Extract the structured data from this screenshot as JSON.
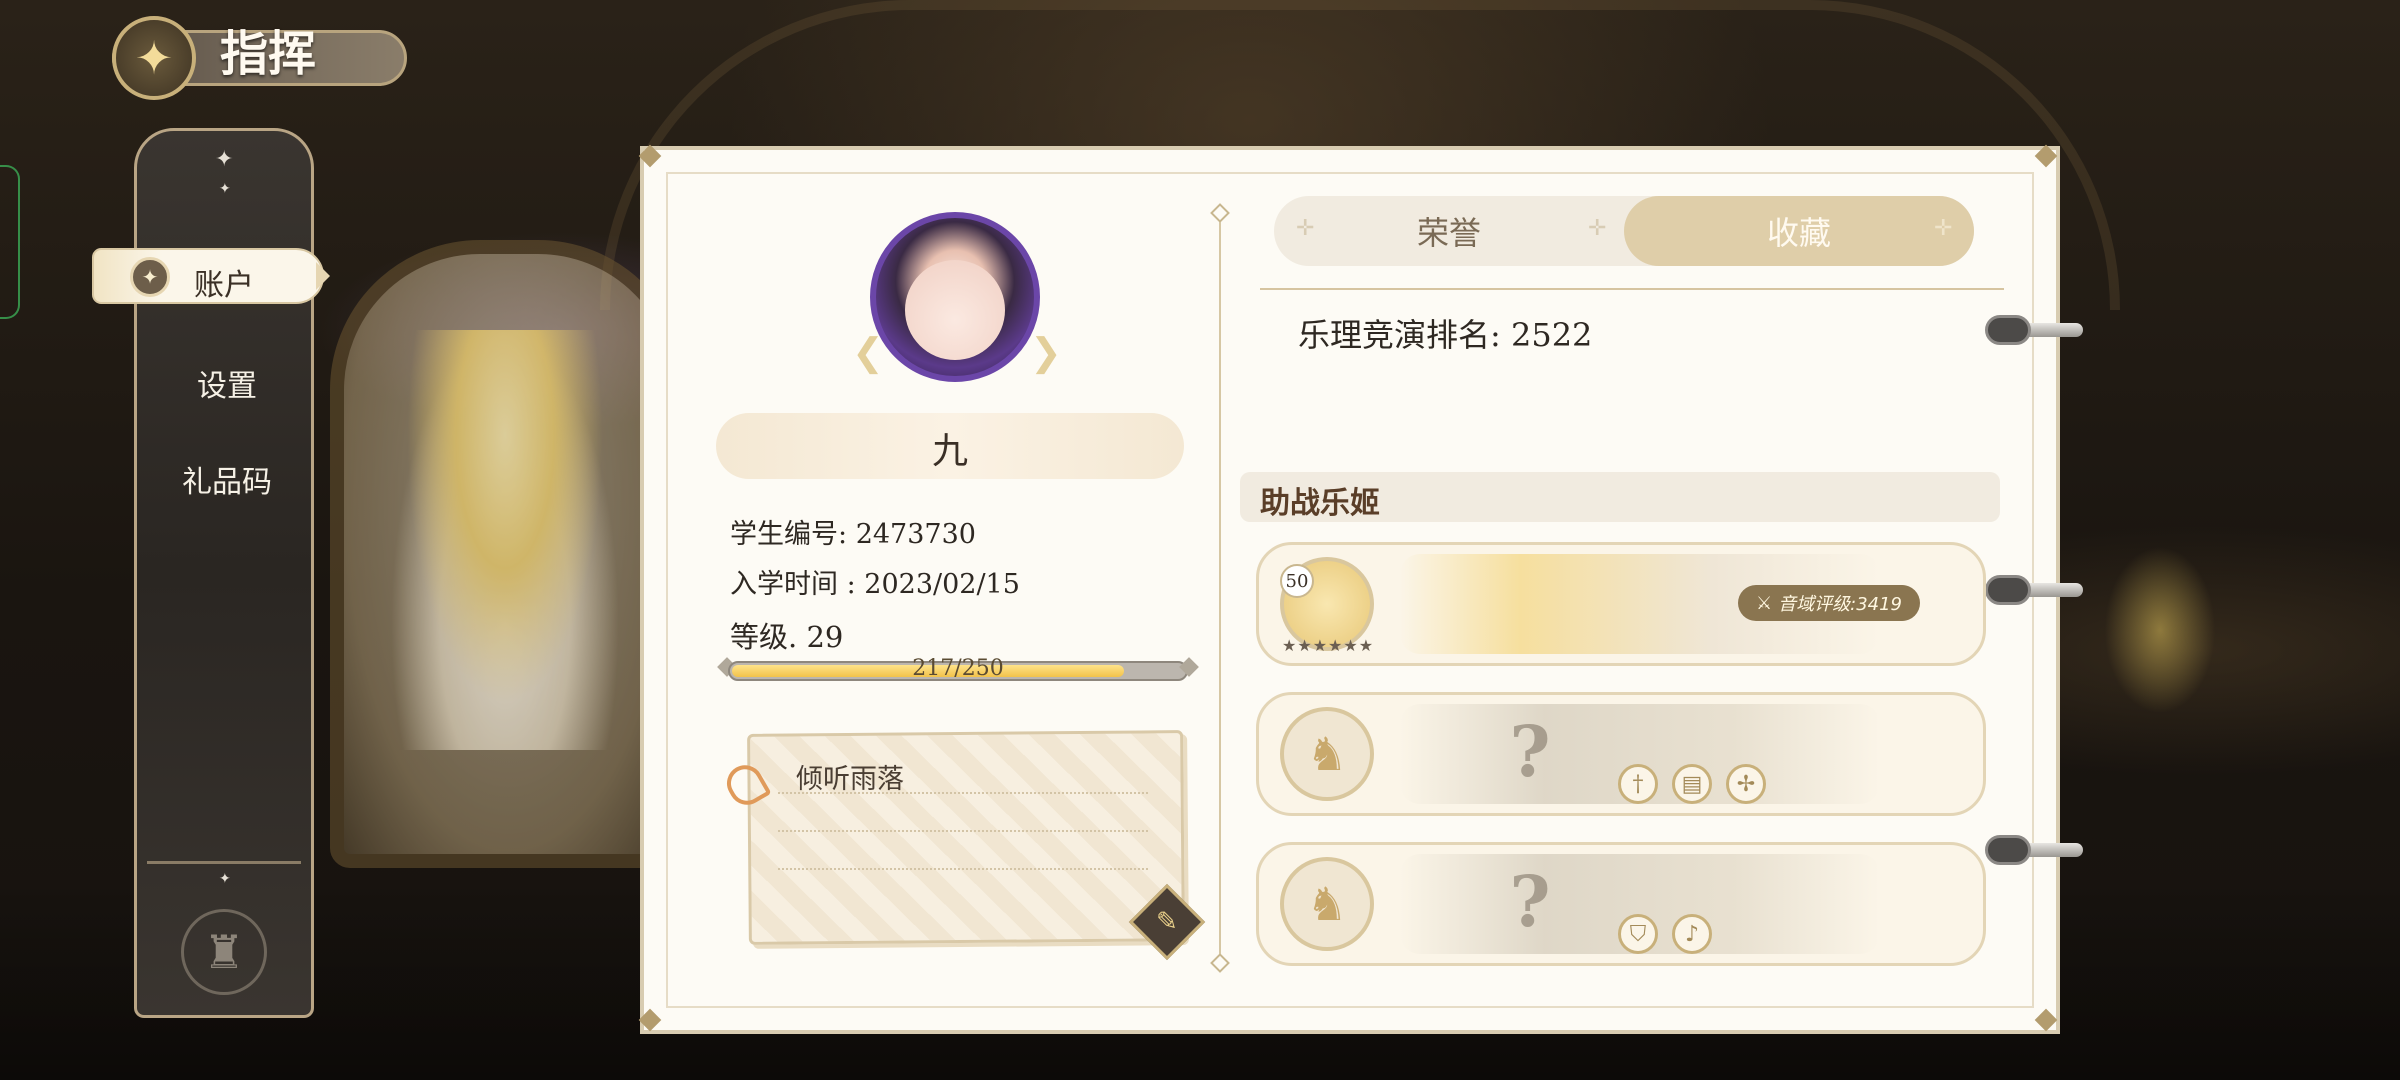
{
  "header": {
    "title": "指挥"
  },
  "sidebar": {
    "items": [
      {
        "label": "账户",
        "active": true
      },
      {
        "label": "设置",
        "active": false
      },
      {
        "label": "礼品码",
        "active": false
      }
    ]
  },
  "profile": {
    "name": "九",
    "student_id_label": "学生编号:",
    "student_id": "2473730",
    "enroll_label": "入学时间 :",
    "enroll_date": "2023/02/15",
    "level_label": "等级.",
    "level": "29",
    "xp_text": "217/250",
    "xp_fraction": 0.868,
    "note": "倾听雨落"
  },
  "tabs": {
    "honor": "荣誉",
    "collection": "收藏",
    "active": "collection"
  },
  "ranking": {
    "label": "乐理竞演排名:",
    "value": "2522"
  },
  "support": {
    "title": "助战乐姬",
    "slot1": {
      "level": "50",
      "stars": "★★★★★★",
      "rating": "音域评级:3419"
    }
  },
  "colors": {
    "accent_gold": "#c8b07a",
    "panel_bg": "#fdfbf5",
    "tab_active": "#dfcea9"
  },
  "icons": [
    "director-emblem-icon",
    "account-icon",
    "crest-icon",
    "pin-icon",
    "quill-icon",
    "sword-icon",
    "lute-icon",
    "book-icon",
    "bow-icon",
    "shield-icon",
    "harp-icon"
  ]
}
